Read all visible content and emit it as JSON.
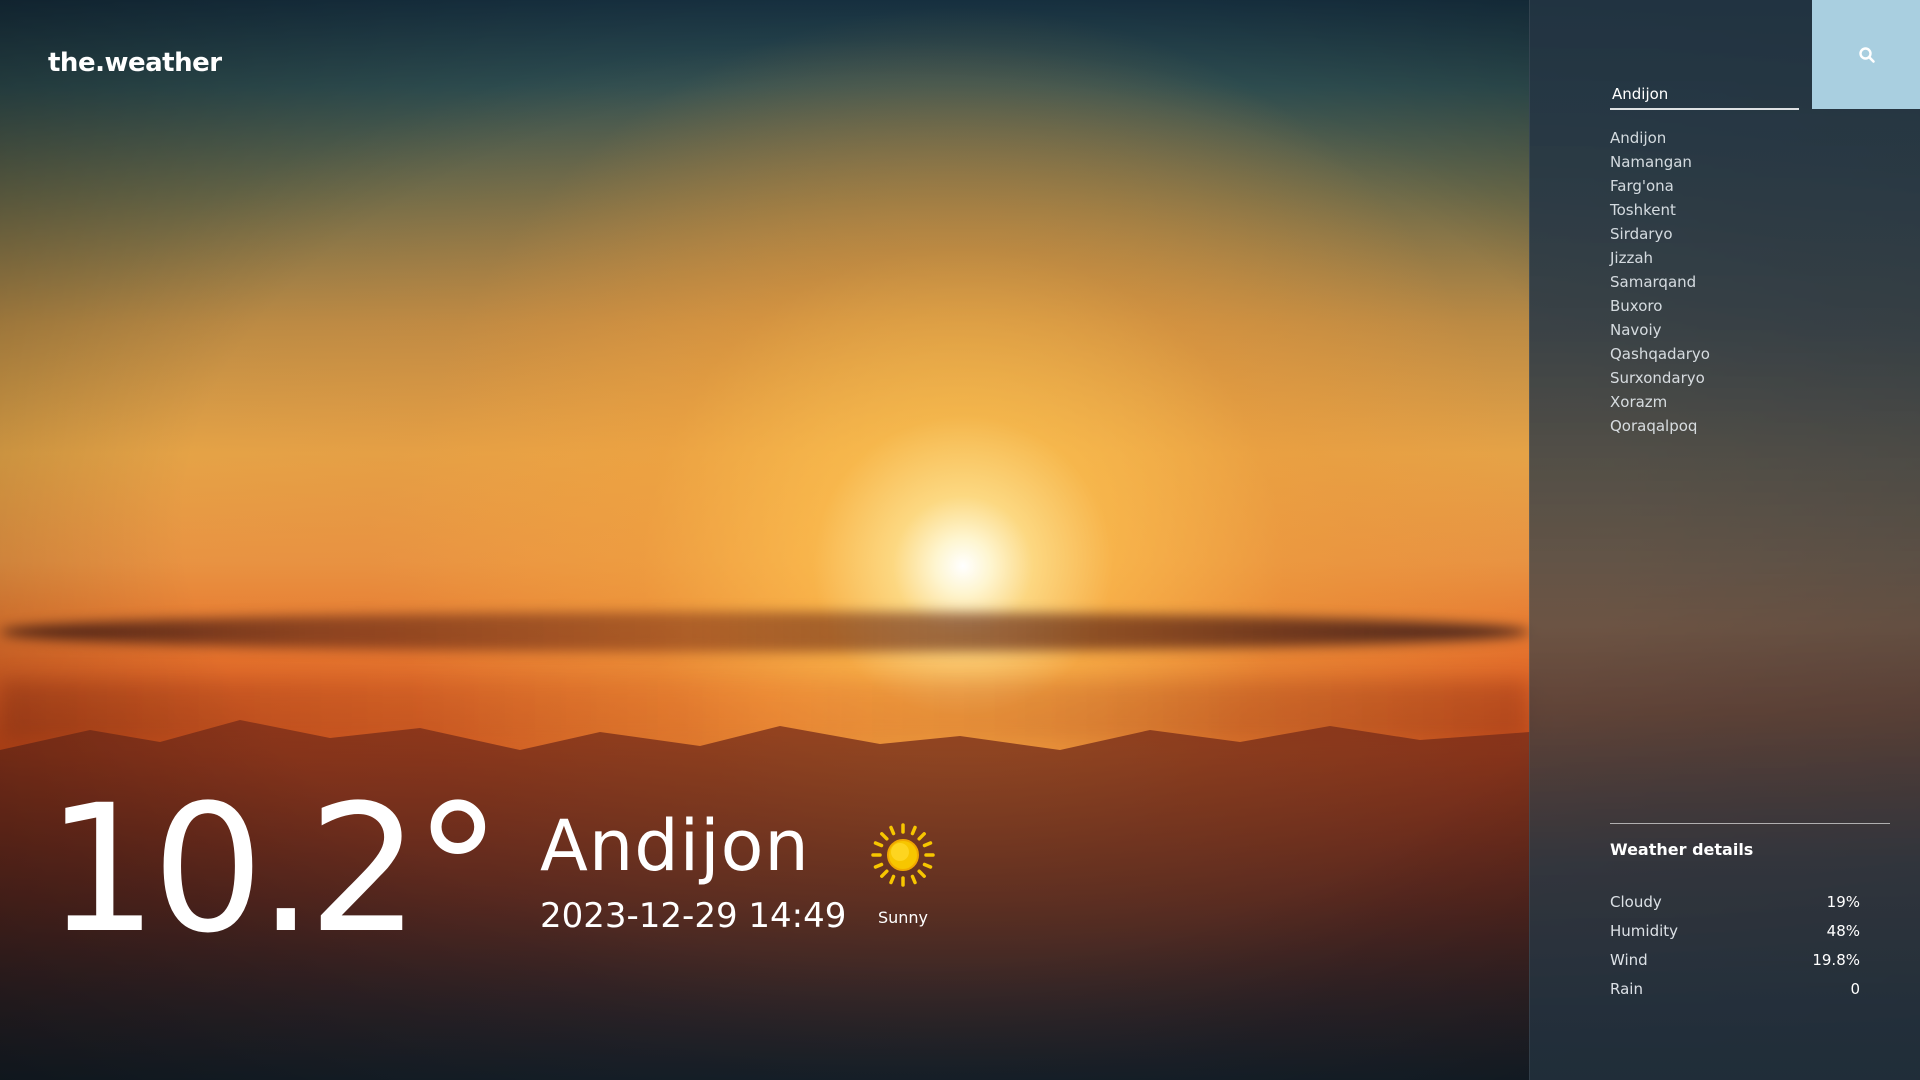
{
  "app": {
    "logo": "the.weather"
  },
  "current": {
    "temperature": "10.2°",
    "city": "Andijon",
    "datetime": "2023-12-29 14:49",
    "condition": "Sunny",
    "condition_icon": "sun-icon"
  },
  "sidebar": {
    "search_value": "Andijon",
    "search_icon": "search-icon",
    "cities": [
      "Andijon",
      "Namangan",
      "Farg'ona",
      "Toshkent",
      "Sirdaryo",
      "Jizzah",
      "Samarqand",
      "Buxoro",
      "Navoiy",
      "Qashqadaryo",
      "Surxondaryo",
      "Xorazm",
      "Qoraqalpoq"
    ],
    "details_title": "Weather details",
    "details": [
      {
        "label": "Cloudy",
        "value": "19%"
      },
      {
        "label": "Humidity",
        "value": "48%"
      },
      {
        "label": "Wind",
        "value": "19.8%"
      },
      {
        "label": "Rain",
        "value": "0"
      }
    ]
  },
  "colors": {
    "search_button": "#a9cfe0",
    "text": "#ffffff",
    "sun": "#f7c600"
  }
}
